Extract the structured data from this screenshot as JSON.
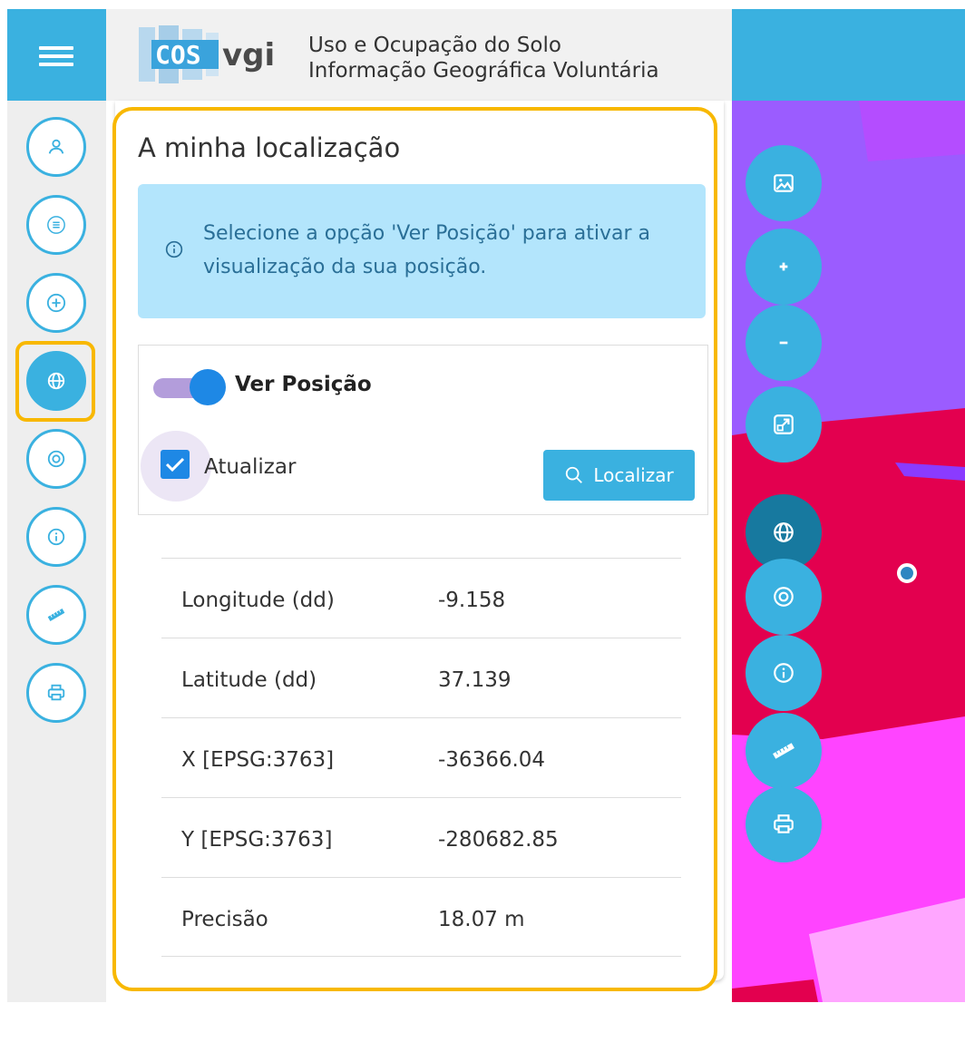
{
  "app": {
    "logo_text": "COS vgi",
    "title_line1": "Uso e Ocupação do Solo",
    "title_line2": "Informação Geográfica Voluntária"
  },
  "rail": {
    "items": [
      {
        "icon": "user-icon",
        "active": false
      },
      {
        "icon": "list-icon",
        "active": false
      },
      {
        "icon": "add-circle-icon",
        "active": false
      },
      {
        "icon": "globe-icon",
        "active": true
      },
      {
        "icon": "target-icon",
        "active": false
      },
      {
        "icon": "info-icon",
        "active": false
      },
      {
        "icon": "ruler-icon",
        "active": false
      },
      {
        "icon": "printer-icon",
        "active": false
      }
    ]
  },
  "panel": {
    "title": "A minha localização",
    "info": "Selecione a opção 'Ver Posição' para ativar a visualização da sua posição.",
    "toggle_label": "Ver Posição",
    "toggle_on": true,
    "checkbox_label": "Atualizar",
    "checkbox_checked": true,
    "locate_button": "Localizar",
    "rows": [
      {
        "label": "Longitude (dd)",
        "value": "-9.158"
      },
      {
        "label": "Latitude (dd)",
        "value": "37.139"
      },
      {
        "label": "X [EPSG:3763]",
        "value": "-36366.04"
      },
      {
        "label": "Y [EPSG:3763]",
        "value": "-280682.85"
      },
      {
        "label": "Precisão",
        "value": "18.07 m"
      }
    ]
  },
  "map": {
    "controls": [
      {
        "icon": "image-icon"
      },
      {
        "icon": "plus-icon"
      },
      {
        "icon": "minus-icon"
      },
      {
        "icon": "fullscreen-icon"
      },
      {
        "icon": "globe-icon",
        "active": true
      },
      {
        "icon": "target-icon"
      },
      {
        "icon": "info-icon"
      },
      {
        "icon": "ruler-icon"
      },
      {
        "icon": "printer-icon"
      }
    ]
  },
  "colors": {
    "accent": "#3ab1e0",
    "focus": "#f8b800",
    "info_bg": "#b3e5fc",
    "map_purple": "#9b5cff",
    "map_crimson": "#e3004f",
    "map_magenta": "#ff44ff"
  }
}
